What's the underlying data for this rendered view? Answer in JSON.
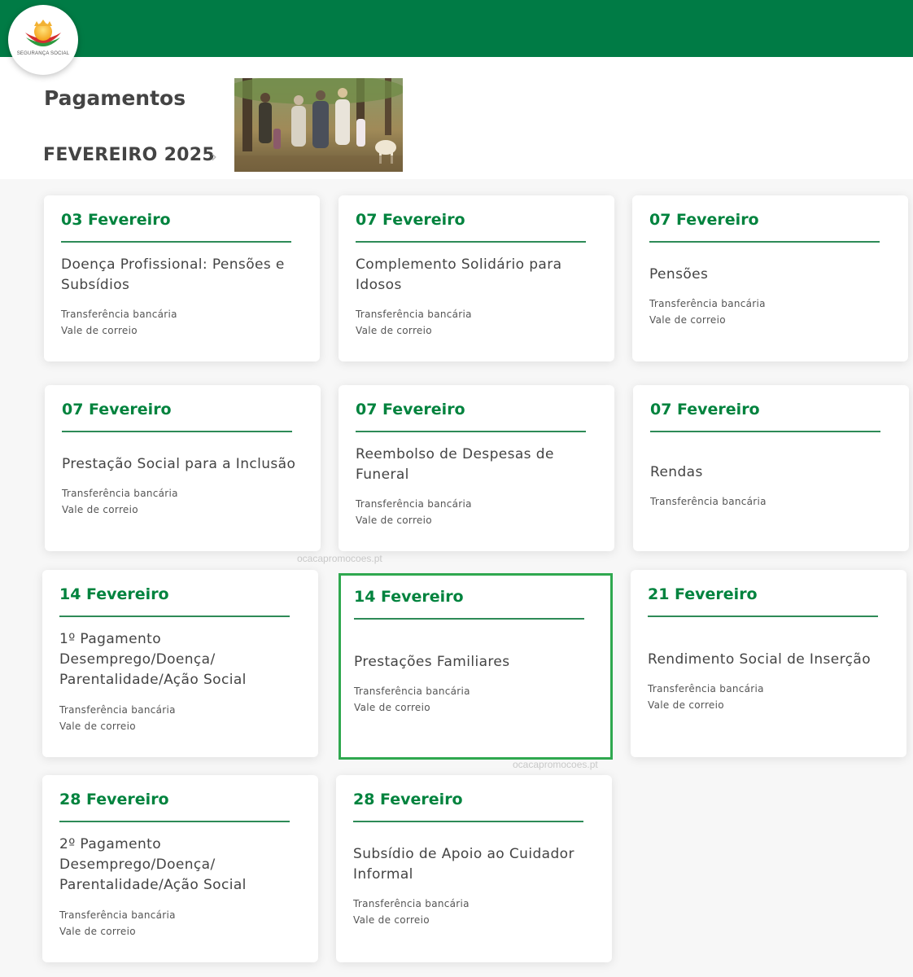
{
  "brand": {
    "logo_text": "SEGURANÇA SOCIAL",
    "primary_color": "#007b45",
    "accent_color": "#00833e",
    "selected_border_color": "#2fa84f"
  },
  "page_title": "Pagamentos",
  "month": {
    "label": "FEVEREIRO 2025",
    "chevron": "›"
  },
  "payments": [
    {
      "date": "03 Fevereiro",
      "title": "Doença Profissional: Pensões e Subsídios",
      "methods": [
        "Transferência bancária",
        "Vale de correio"
      ]
    },
    {
      "date": "07 Fevereiro",
      "title": "Complemento Solidário para Idosos",
      "methods": [
        "Transferência bancária",
        "Vale de correio"
      ]
    },
    {
      "date": "07 Fevereiro",
      "title": "Pensões",
      "methods": [
        "Transferência bancária",
        "Vale de correio"
      ]
    },
    {
      "date": "07 Fevereiro",
      "title": "Prestação Social para a Inclusão",
      "methods": [
        "Transferência bancária",
        "Vale de correio"
      ]
    },
    {
      "date": "07 Fevereiro",
      "title": "Reembolso de Despesas de Funeral",
      "methods": [
        "Transferência bancária",
        "Vale de correio"
      ]
    },
    {
      "date": "07 Fevereiro",
      "title": "Rendas",
      "methods": [
        "Transferência bancária"
      ]
    },
    {
      "date": "14 Fevereiro",
      "title": "1º Pagamento Desemprego/Doença/ Parentalidade/Ação Social",
      "methods": [
        "Transferência bancária",
        "Vale de correio"
      ]
    },
    {
      "date": "14 Fevereiro",
      "title": "Prestações Familiares",
      "methods": [
        "Transferência bancária",
        "Vale de correio"
      ],
      "selected": true
    },
    {
      "date": "21 Fevereiro",
      "title": "Rendimento Social de Inserção",
      "methods": [
        "Transferência bancária",
        "Vale de correio"
      ]
    },
    {
      "date": "28 Fevereiro",
      "title": "2º Pagamento Desemprego/Doença/ Parentalidade/Ação Social",
      "methods": [
        "Transferência bancária",
        "Vale de correio"
      ]
    },
    {
      "date": "28 Fevereiro",
      "title": "Subsídio de Apoio ao Cuidador Informal",
      "methods": [
        "Transferência bancária",
        "Vale de correio"
      ]
    }
  ],
  "watermark": "ocacapromocoes.pt"
}
